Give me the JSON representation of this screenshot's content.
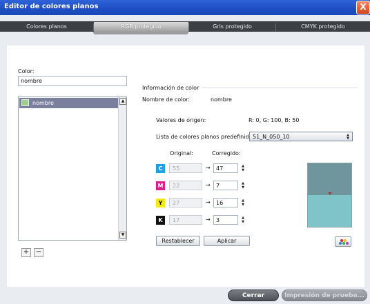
{
  "window": {
    "title": "Editor de colores planos",
    "close_glyph": "X"
  },
  "tabs": [
    {
      "label": "Colores planos",
      "active": false
    },
    {
      "label": "RGB protegido",
      "active": true
    },
    {
      "label": "Gris protegido",
      "active": false
    },
    {
      "label": "CMYK protegido",
      "active": false
    }
  ],
  "color_filter": {
    "label": "Color:",
    "value": "nombre"
  },
  "color_list": {
    "items": [
      {
        "label": "nombre",
        "swatch_color": "#9fd08b",
        "selected": true
      }
    ],
    "add_label": "+",
    "remove_label": "−"
  },
  "info": {
    "section_title": "Información de color",
    "name_label": "Nombre de color:",
    "name_value": "nombre",
    "source_label": "Valores de origen:",
    "source_value": "R: 0, G: 100, B: 50",
    "predefined_label": "Lista de colores planos predefinida:",
    "predefined_value": "51_N_050_10",
    "original_header": "Original:",
    "corrected_header": "Corregido:"
  },
  "channels": [
    {
      "letter": "C",
      "color": "#1aa3e0",
      "letter_color": "#ffffff",
      "original": "55",
      "corrected": "47"
    },
    {
      "letter": "M",
      "color": "#e01e8c",
      "letter_color": "#ffffff",
      "original": "22",
      "corrected": "7"
    },
    {
      "letter": "Y",
      "color": "#f6ea12",
      "letter_color": "#111111",
      "original": "27",
      "corrected": "16"
    },
    {
      "letter": "K",
      "color": "#111111",
      "letter_color": "#ffffff",
      "original": "17",
      "corrected": "3"
    }
  ],
  "preview": {
    "original_color": "#6f969d",
    "corrected_color": "#7ec4c9"
  },
  "actions": {
    "reset": "Restablecer",
    "apply": "Aplicar"
  },
  "footer": {
    "close": "Cerrar",
    "proof_print": "Impresión de prueba..."
  },
  "icons": {
    "arrow": "→",
    "palette": "palette-icon"
  }
}
